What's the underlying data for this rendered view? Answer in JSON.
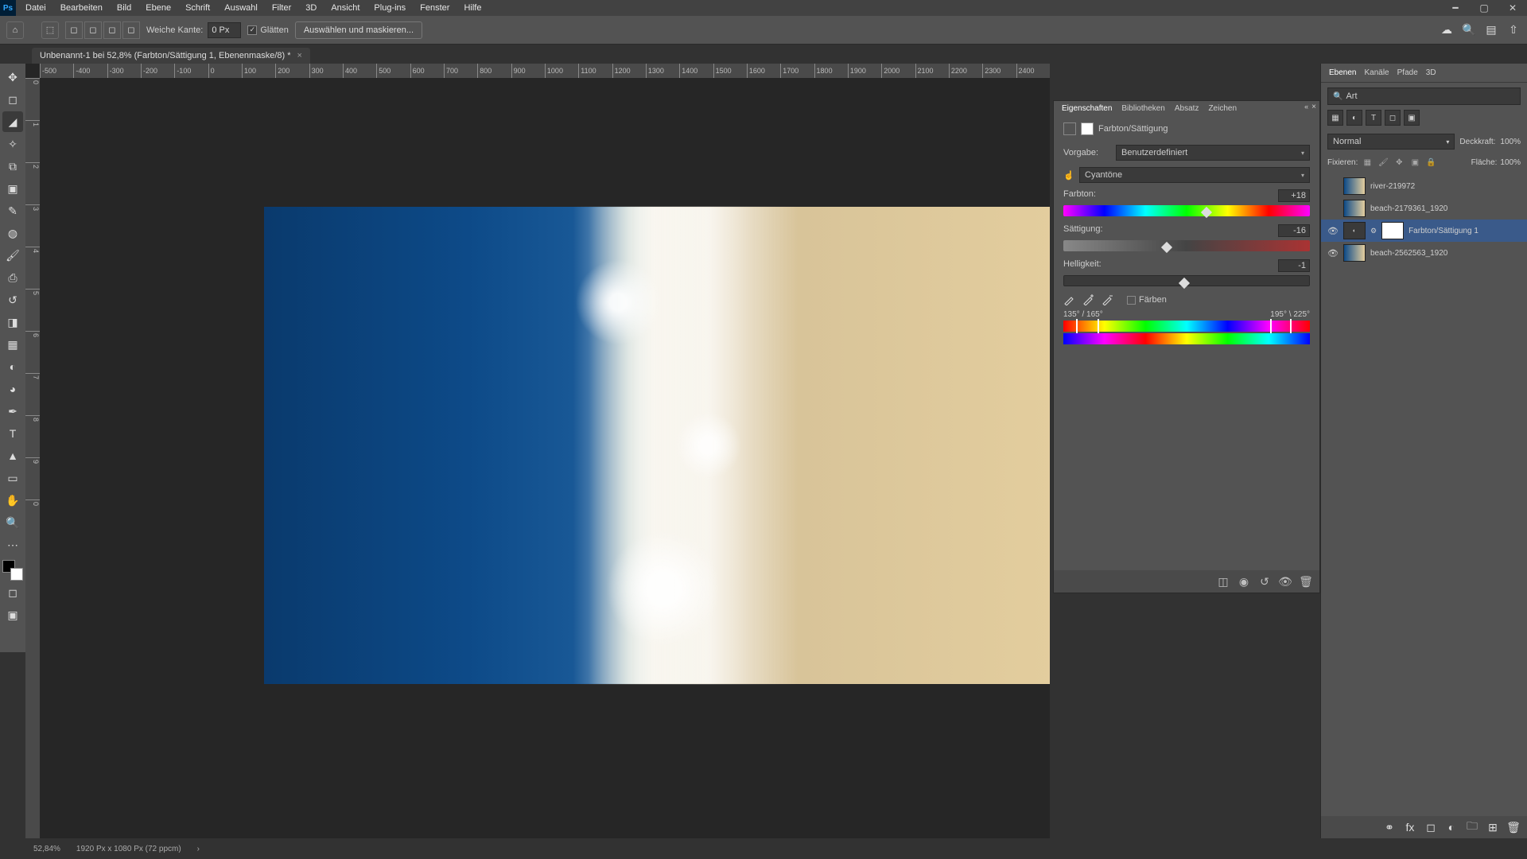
{
  "menu": [
    "Datei",
    "Bearbeiten",
    "Bild",
    "Ebene",
    "Schrift",
    "Auswahl",
    "Filter",
    "3D",
    "Ansicht",
    "Plug-ins",
    "Fenster",
    "Hilfe"
  ],
  "optionsBar": {
    "feather_label": "Weiche Kante:",
    "feather_value": "0 Px",
    "antialias": "Glätten",
    "refine": "Auswählen und maskieren..."
  },
  "document": {
    "tab_title": "Unbenannt-1 bei 52,8% (Farbton/Sättigung 1, Ebenenmaske/8) *"
  },
  "ruler_h": [
    "-500",
    "-400",
    "-300",
    "-200",
    "-100",
    "0",
    "100",
    "200",
    "300",
    "400",
    "500",
    "600",
    "700",
    "800",
    "900",
    "1000",
    "1100",
    "1200",
    "1300",
    "1400",
    "1500",
    "1600",
    "1700",
    "1800",
    "1900",
    "2000",
    "2100",
    "2200",
    "2300",
    "2400"
  ],
  "ruler_v": [
    "0",
    "1",
    "2",
    "3",
    "4",
    "5",
    "6",
    "7",
    "8",
    "9",
    "0"
  ],
  "properties": {
    "tabs": [
      "Eigenschaften",
      "Bibliotheken",
      "Absatz",
      "Zeichen"
    ],
    "adj_type": "Farbton/Sättigung",
    "preset_label": "Vorgabe:",
    "preset": "Benutzerdefiniert",
    "channel": "Cyantöne",
    "hue_label": "Farbton:",
    "hue_value": "+18",
    "sat_label": "Sättigung:",
    "sat_value": "-16",
    "lig_label": "Helligkeit:",
    "lig_value": "-1",
    "colorize": "Färben",
    "range_left": "135° / 165°",
    "range_right": "195° \\ 225°"
  },
  "layersPanel": {
    "tabs": [
      "Ebenen",
      "Kanäle",
      "Pfade",
      "3D"
    ],
    "kind": "Art",
    "blend": "Normal",
    "opacity_label": "Deckkraft:",
    "opacity": "100%",
    "lock_label": "Fixieren:",
    "fill_label": "Fläche:",
    "fill": "100%",
    "layers": [
      {
        "name": "river-219972",
        "eye": false
      },
      {
        "name": "beach-2179361_1920",
        "eye": false
      },
      {
        "name": "Farbton/Sättigung 1",
        "eye": true,
        "adj": true,
        "sel": true
      },
      {
        "name": "beach-2562563_1920",
        "eye": true
      }
    ]
  },
  "status": {
    "zoom": "52,84%",
    "doc": "1920 Px x 1080 Px (72 ppcm)"
  }
}
